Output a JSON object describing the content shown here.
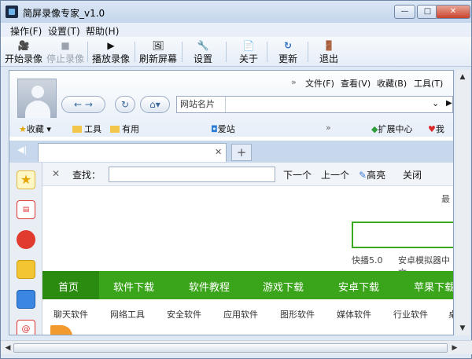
{
  "window": {
    "title": "简屏录像专家_v1.0",
    "min": "—",
    "max": "□",
    "close": "✕"
  },
  "menu": [
    "操作(F)",
    "设置(T)",
    "帮助(H)"
  ],
  "toolbar": [
    {
      "label": "开始录像",
      "icon": "🎥",
      "enabled": true
    },
    {
      "label": "停止录像",
      "icon": "■",
      "enabled": false
    },
    {
      "label": "播放录像",
      "icon": "▶",
      "enabled": true
    },
    {
      "label": "刷新屏幕",
      "icon": "🖼",
      "enabled": true
    },
    {
      "label": "设置",
      "icon": "🔧",
      "enabled": true
    },
    {
      "label": "关于",
      "icon": "📄",
      "enabled": true
    },
    {
      "label": "更新",
      "icon": "↻",
      "enabled": true
    },
    {
      "label": "退出",
      "icon": "🚪",
      "enabled": true
    }
  ],
  "browser": {
    "topmenu": [
      "文件(F)",
      "查看(V)",
      "收藏(B)",
      "工具(T)"
    ],
    "more": "»",
    "address_dropdown": "网站名片",
    "favorites": {
      "collect": "收藏",
      "tools": "工具",
      "useful": "有用",
      "aizhan": "爱站",
      "ext": "扩展中心",
      "mine": "我",
      "more": "»"
    },
    "find": {
      "label": "查找：",
      "next": "下一个",
      "prev": "上一个",
      "highlight": "高亮",
      "close": "关闭"
    },
    "page": {
      "latest": "最",
      "kuaibo": "快播5.0",
      "android": "安卓模拟器中文",
      "nav": [
        "首页",
        "软件下载",
        "软件教程",
        "游戏下载",
        "安卓下载",
        "苹果下载"
      ],
      "subnav": [
        "聊天软件",
        "网络工具",
        "安全软件",
        "应用软件",
        "图形软件",
        "媒体软件",
        "行业软件",
        "桌"
      ]
    }
  }
}
